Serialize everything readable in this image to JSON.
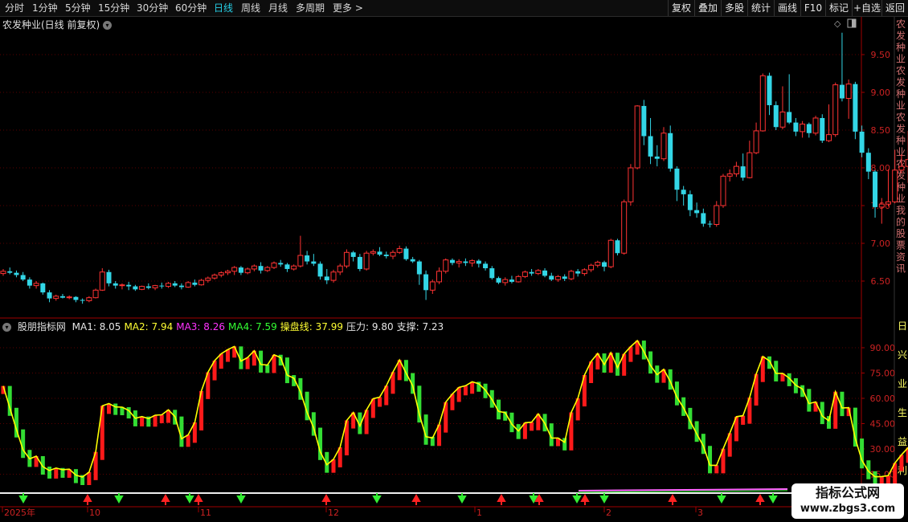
{
  "toolbar": {
    "periods": [
      {
        "label": "分时"
      },
      {
        "label": "1分钟"
      },
      {
        "label": "5分钟"
      },
      {
        "label": "15分钟"
      },
      {
        "label": "30分钟"
      },
      {
        "label": "60分钟"
      },
      {
        "label": "日线",
        "active": true
      },
      {
        "label": "周线"
      },
      {
        "label": "月线"
      },
      {
        "label": "多周期"
      },
      {
        "label": "更多 >"
      }
    ],
    "actions": [
      {
        "label": "复权"
      },
      {
        "label": "叠加"
      },
      {
        "label": "多股"
      },
      {
        "label": "统计"
      },
      {
        "label": "画线"
      },
      {
        "label": "F10"
      },
      {
        "label": "标记"
      },
      {
        "label": "+自选"
      },
      {
        "label": "返回"
      }
    ]
  },
  "stock_title": "农发种业(日线 前复权)",
  "indicator": {
    "name": "股朋指标网",
    "values": [
      {
        "text": "MA1: 8.05",
        "color": "#e6e6e6"
      },
      {
        "text": "MA2: 7.94",
        "color": "#ffff33"
      },
      {
        "text": "MA3: 8.26",
        "color": "#ff33ff"
      },
      {
        "text": "MA4: 7.59",
        "color": "#33ff33"
      },
      {
        "text": "操盘线: 37.99",
        "color": "#ffff33"
      },
      {
        "text": "压力: 9.80",
        "color": "#e6e6e6"
      },
      {
        "text": "支撑: 7.23",
        "color": "#e6e6e6"
      }
    ],
    "curve_tag": "操盘线"
  },
  "colors": {
    "up": "#ff3333",
    "down": "#33d6e6",
    "bar_up": "#ff1a1a",
    "bar_down": "#33dd33",
    "line": "#ffff00",
    "axis": "#a00000",
    "grid": "#5a0000"
  },
  "price_axis": {
    "ticks": [
      "9.50",
      "9.00",
      "8.50",
      "8.00",
      "7.50",
      "7.00",
      "6.50"
    ]
  },
  "indicator_axis": {
    "ticks": [
      "90.00",
      "75.00",
      "60.00",
      "45.00",
      "30.00",
      "15.00"
    ]
  },
  "right_strip": {
    "upper": "农发种业农发种业农发种业农发种业我的股票资讯",
    "lower": "日兴业生益利"
  },
  "x_axis": {
    "labels": [
      "2025年",
      "10",
      "11",
      "12",
      "1",
      "2",
      "3"
    ]
  },
  "watermark": {
    "line1": "指标公式网",
    "line2": "www.zbgs3.com"
  },
  "chart_data": {
    "type": "candlestick",
    "candles": [
      [
        6.6,
        6.66,
        6.57,
        6.63
      ],
      [
        6.63,
        6.68,
        6.59,
        6.61
      ],
      [
        6.61,
        6.64,
        6.55,
        6.58
      ],
      [
        6.58,
        6.62,
        6.5,
        6.52
      ],
      [
        6.52,
        6.55,
        6.4,
        6.44
      ],
      [
        6.44,
        6.5,
        6.4,
        6.47
      ],
      [
        6.47,
        6.48,
        6.32,
        6.35
      ],
      [
        6.35,
        6.38,
        6.22,
        6.27
      ],
      [
        6.27,
        6.32,
        6.24,
        6.3
      ],
      [
        6.3,
        6.33,
        6.27,
        6.28
      ],
      [
        6.28,
        6.31,
        6.26,
        6.29
      ],
      [
        6.29,
        6.3,
        6.22,
        6.25
      ],
      [
        6.25,
        6.27,
        6.2,
        6.24
      ],
      [
        6.24,
        6.3,
        6.22,
        6.28
      ],
      [
        6.28,
        6.4,
        6.27,
        6.38
      ],
      [
        6.38,
        6.67,
        6.37,
        6.62
      ],
      [
        6.62,
        6.65,
        6.43,
        6.47
      ],
      [
        6.47,
        6.5,
        6.4,
        6.44
      ],
      [
        6.44,
        6.47,
        6.39,
        6.45
      ],
      [
        6.45,
        6.49,
        6.38,
        6.43
      ],
      [
        6.43,
        6.45,
        6.37,
        6.39
      ],
      [
        6.39,
        6.44,
        6.38,
        6.43
      ],
      [
        6.43,
        6.47,
        6.39,
        6.41
      ],
      [
        6.41,
        6.45,
        6.38,
        6.44
      ],
      [
        6.44,
        6.48,
        6.4,
        6.43
      ],
      [
        6.43,
        6.49,
        6.41,
        6.47
      ],
      [
        6.47,
        6.5,
        6.42,
        6.44
      ],
      [
        6.44,
        6.47,
        6.39,
        6.42
      ],
      [
        6.42,
        6.5,
        6.41,
        6.48
      ],
      [
        6.48,
        6.52,
        6.43,
        6.45
      ],
      [
        6.45,
        6.53,
        6.44,
        6.51
      ],
      [
        6.51,
        6.56,
        6.48,
        6.54
      ],
      [
        6.54,
        6.6,
        6.52,
        6.58
      ],
      [
        6.58,
        6.63,
        6.55,
        6.61
      ],
      [
        6.61,
        6.65,
        6.58,
        6.63
      ],
      [
        6.63,
        6.7,
        6.58,
        6.68
      ],
      [
        6.68,
        6.7,
        6.58,
        6.61
      ],
      [
        6.61,
        6.68,
        6.59,
        6.66
      ],
      [
        6.66,
        6.72,
        6.63,
        6.7
      ],
      [
        6.7,
        6.75,
        6.6,
        6.64
      ],
      [
        6.64,
        6.7,
        6.62,
        6.68
      ],
      [
        6.68,
        6.76,
        6.66,
        6.74
      ],
      [
        6.74,
        6.78,
        6.69,
        6.72
      ],
      [
        6.72,
        6.74,
        6.62,
        6.66
      ],
      [
        6.66,
        6.72,
        6.64,
        6.7
      ],
      [
        6.7,
        7.1,
        6.68,
        6.84
      ],
      [
        6.84,
        6.9,
        6.72,
        6.76
      ],
      [
        6.76,
        6.86,
        6.7,
        6.73
      ],
      [
        6.73,
        6.76,
        6.52,
        6.56
      ],
      [
        6.56,
        6.66,
        6.46,
        6.51
      ],
      [
        6.51,
        6.65,
        6.48,
        6.62
      ],
      [
        6.62,
        6.73,
        6.58,
        6.7
      ],
      [
        6.7,
        6.92,
        6.67,
        6.88
      ],
      [
        6.88,
        6.9,
        6.76,
        6.82
      ],
      [
        6.82,
        6.86,
        6.63,
        6.66
      ],
      [
        6.66,
        6.9,
        6.64,
        6.87
      ],
      [
        6.87,
        6.92,
        6.84,
        6.89
      ],
      [
        6.89,
        6.95,
        6.83,
        6.85
      ],
      [
        6.85,
        6.89,
        6.8,
        6.83
      ],
      [
        6.83,
        6.91,
        6.79,
        6.88
      ],
      [
        6.88,
        6.97,
        6.86,
        6.93
      ],
      [
        6.93,
        6.96,
        6.77,
        6.79
      ],
      [
        6.79,
        6.82,
        6.74,
        6.76
      ],
      [
        6.76,
        6.78,
        6.45,
        6.59
      ],
      [
        6.59,
        6.64,
        6.25,
        6.38
      ],
      [
        6.38,
        6.52,
        6.33,
        6.49
      ],
      [
        6.49,
        6.68,
        6.46,
        6.63
      ],
      [
        6.63,
        6.8,
        6.6,
        6.78
      ],
      [
        6.78,
        6.8,
        6.71,
        6.74
      ],
      [
        6.74,
        6.79,
        6.68,
        6.76
      ],
      [
        6.76,
        6.8,
        6.7,
        6.74
      ],
      [
        6.74,
        6.79,
        6.69,
        6.77
      ],
      [
        6.77,
        6.79,
        6.68,
        6.73
      ],
      [
        6.73,
        6.76,
        6.64,
        6.67
      ],
      [
        6.67,
        6.7,
        6.52,
        6.54
      ],
      [
        6.54,
        6.56,
        6.46,
        6.48
      ],
      [
        6.48,
        6.55,
        6.44,
        6.52
      ],
      [
        6.52,
        6.57,
        6.47,
        6.49
      ],
      [
        6.49,
        6.58,
        6.48,
        6.56
      ],
      [
        6.56,
        6.64,
        6.54,
        6.62
      ],
      [
        6.62,
        6.66,
        6.57,
        6.6
      ],
      [
        6.6,
        6.66,
        6.58,
        6.64
      ],
      [
        6.64,
        6.67,
        6.55,
        6.57
      ],
      [
        6.57,
        6.61,
        6.5,
        6.52
      ],
      [
        6.52,
        6.58,
        6.49,
        6.56
      ],
      [
        6.56,
        6.59,
        6.5,
        6.53
      ],
      [
        6.53,
        6.65,
        6.51,
        6.63
      ],
      [
        6.63,
        6.66,
        6.56,
        6.6
      ],
      [
        6.6,
        6.67,
        6.57,
        6.65
      ],
      [
        6.65,
        6.73,
        6.62,
        6.71
      ],
      [
        6.71,
        6.77,
        6.68,
        6.75
      ],
      [
        6.75,
        6.77,
        6.63,
        6.69
      ],
      [
        6.69,
        7.06,
        6.67,
        7.04
      ],
      [
        7.04,
        7.06,
        6.84,
        6.87
      ],
      [
        6.87,
        7.58,
        6.85,
        7.55
      ],
      [
        7.55,
        8.05,
        7.5,
        8.0
      ],
      [
        8.0,
        8.83,
        7.98,
        8.82
      ],
      [
        8.82,
        8.9,
        8.3,
        8.42
      ],
      [
        8.42,
        8.66,
        8.05,
        8.15
      ],
      [
        8.15,
        8.3,
        8.02,
        8.12
      ],
      [
        8.12,
        8.54,
        8.09,
        8.46
      ],
      [
        8.46,
        8.56,
        7.95,
        7.99
      ],
      [
        7.99,
        8.02,
        7.56,
        7.71
      ],
      [
        7.71,
        7.76,
        7.5,
        7.65
      ],
      [
        7.65,
        7.7,
        7.36,
        7.44
      ],
      [
        7.44,
        7.54,
        7.34,
        7.4
      ],
      [
        7.4,
        7.46,
        7.22,
        7.26
      ],
      [
        7.26,
        7.3,
        7.21,
        7.25
      ],
      [
        7.25,
        7.56,
        7.22,
        7.5
      ],
      [
        7.5,
        7.92,
        7.47,
        7.89
      ],
      [
        7.89,
        7.98,
        7.82,
        7.92
      ],
      [
        7.92,
        8.08,
        7.88,
        8.02
      ],
      [
        8.02,
        8.19,
        7.83,
        7.87
      ],
      [
        7.87,
        8.36,
        7.86,
        8.2
      ],
      [
        8.2,
        8.6,
        8.18,
        8.49
      ],
      [
        8.49,
        9.25,
        8.48,
        9.22
      ],
      [
        9.22,
        9.26,
        8.7,
        8.83
      ],
      [
        8.83,
        8.88,
        8.5,
        8.54
      ],
      [
        8.54,
        9.08,
        8.51,
        8.74
      ],
      [
        8.74,
        9.24,
        8.58,
        8.6
      ],
      [
        8.6,
        8.66,
        8.42,
        8.48
      ],
      [
        8.48,
        8.62,
        8.4,
        8.58
      ],
      [
        8.58,
        8.6,
        8.4,
        8.46
      ],
      [
        8.46,
        8.69,
        8.43,
        8.66
      ],
      [
        8.66,
        8.71,
        8.33,
        8.36
      ],
      [
        8.36,
        8.84,
        8.34,
        8.44
      ],
      [
        8.44,
        9.13,
        8.41,
        9.1
      ],
      [
        9.1,
        9.79,
        8.88,
        8.92
      ],
      [
        8.92,
        9.17,
        8.65,
        9.11
      ],
      [
        9.11,
        9.14,
        8.38,
        8.48
      ],
      [
        8.48,
        8.56,
        8.14,
        8.2
      ],
      [
        8.2,
        8.26,
        7.85,
        7.95
      ],
      [
        7.95,
        7.97,
        7.34,
        7.48
      ],
      [
        7.48,
        7.6,
        7.26,
        7.52
      ],
      [
        7.52,
        7.98,
        7.49,
        7.55
      ],
      [
        7.55,
        8.24,
        7.53,
        7.97
      ],
      [
        7.97,
        8.18,
        7.93,
        8.02
      ],
      [
        8.02,
        8.49,
        7.8,
        8.11
      ],
      [
        8.11,
        8.4,
        7.87,
        7.98
      ],
      [
        7.98,
        8.53,
        7.95,
        8.49
      ],
      [
        8.49,
        8.75,
        8.38,
        8.4
      ],
      [
        8.4,
        8.48,
        7.97,
        8.05
      ],
      [
        8.05,
        8.11,
        7.72,
        7.86
      ]
    ]
  }
}
